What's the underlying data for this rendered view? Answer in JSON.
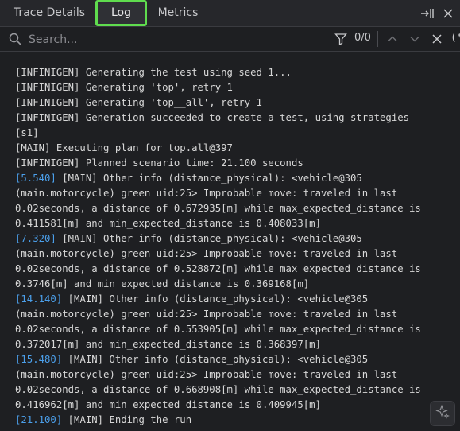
{
  "tabs": {
    "trace_details": "Trace Details",
    "log": "Log",
    "metrics": "Metrics"
  },
  "search": {
    "placeholder": "Search...",
    "match_count": "0/0",
    "regex_label": "(*)"
  },
  "accent_color": "#5fdc4e",
  "timestamp_color": "#4b9fea",
  "log_lines": [
    {
      "ts": "",
      "text": "[INFINIGEN] Generating the test using seed 1..."
    },
    {
      "ts": "",
      "text": "[INFINIGEN] Generating 'top', retry 1"
    },
    {
      "ts": "",
      "text": "[INFINIGEN] Generating 'top__all', retry 1"
    },
    {
      "ts": "",
      "text": "[INFINIGEN] Generation succeeded to create a test, using strategies"
    },
    {
      "ts": "",
      "text": "[s1]"
    },
    {
      "ts": "",
      "text": "[MAIN] Executing plan for top.all@397"
    },
    {
      "ts": "",
      "text": "[INFINIGEN] Planned scenario time: 21.100 seconds"
    },
    {
      "ts": "[5.540]",
      "text": " [MAIN] Other info (distance_physical): <vehicle@305"
    },
    {
      "ts": "",
      "text": "(main.motorcycle) green uid:25> Improbable move: traveled in last"
    },
    {
      "ts": "",
      "text": "0.02seconds, a distance of 0.672935[m] while max_expected_distance is"
    },
    {
      "ts": "",
      "text": "0.411581[m] and min_expected_distance is 0.408033[m]"
    },
    {
      "ts": "[7.320]",
      "text": " [MAIN] Other info (distance_physical): <vehicle@305"
    },
    {
      "ts": "",
      "text": "(main.motorcycle) green uid:25> Improbable move: traveled in last"
    },
    {
      "ts": "",
      "text": "0.02seconds, a distance of 0.528872[m] while max_expected_distance is"
    },
    {
      "ts": "",
      "text": "0.3746[m] and min_expected_distance is 0.369168[m]"
    },
    {
      "ts": "[14.140]",
      "text": " [MAIN] Other info (distance_physical): <vehicle@305"
    },
    {
      "ts": "",
      "text": "(main.motorcycle) green uid:25> Improbable move: traveled in last"
    },
    {
      "ts": "",
      "text": "0.02seconds, a distance of 0.553905[m] while max_expected_distance is"
    },
    {
      "ts": "",
      "text": "0.372017[m] and min_expected_distance is 0.368397[m]"
    },
    {
      "ts": "[15.480]",
      "text": " [MAIN] Other info (distance_physical): <vehicle@305"
    },
    {
      "ts": "",
      "text": "(main.motorcycle) green uid:25> Improbable move: traveled in last"
    },
    {
      "ts": "",
      "text": "0.02seconds, a distance of 0.668908[m] while max_expected_distance is"
    },
    {
      "ts": "",
      "text": "0.416962[m] and min_expected_distance is 0.409945[m]"
    },
    {
      "ts": "[21.100]",
      "text": " [MAIN] Ending the run"
    }
  ],
  "icons": {
    "collapse": "collapse-panel-icon",
    "close_panel": "close-icon",
    "search": "search-icon",
    "filter": "filter-icon",
    "prev": "chevron-up-icon",
    "next": "chevron-down-icon",
    "assist": "sparkle-icon"
  }
}
